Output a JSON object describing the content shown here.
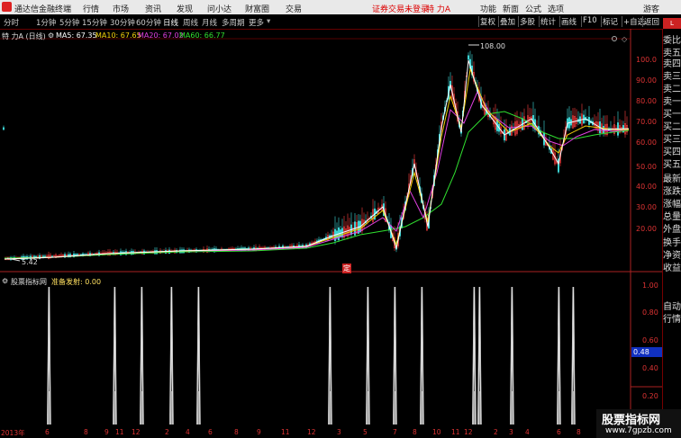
{
  "titlebar": {
    "app_title": "通达信金融终端",
    "menus": [
      "行情",
      "市场",
      "资讯",
      "发现",
      "问小达",
      "财富圈",
      "交易"
    ],
    "notice": "证券交易未登录",
    "stock": "特 力A",
    "right": [
      "功能",
      "新面",
      "公式",
      "选项",
      "游客"
    ]
  },
  "periods": [
    "分时",
    "1分钟",
    "5分钟",
    "15分钟",
    "30分钟",
    "60分钟",
    "日线",
    "周线",
    "月线",
    "多周期",
    "更多"
  ],
  "toolbar": [
    "复权",
    "叠加",
    "多股",
    "统计",
    "画线",
    "F10",
    "标记",
    "+自选",
    "返回"
  ],
  "main_chart": {
    "name_label": "特 力A (日线)",
    "ma": [
      {
        "label": "MA5: 67.35",
        "color": "#ffffff"
      },
      {
        "label": "MA10: 67.65",
        "color": "#f2d20a"
      },
      {
        "label": "MA20: 67.02",
        "color": "#e040e0"
      },
      {
        "label": "MA60: 66.77",
        "color": "#30e030"
      }
    ],
    "high_label": "108.00",
    "low_label": "5.42",
    "flag_label": "定",
    "y_labels": [
      "100.0",
      "90.00",
      "80.00",
      "70.00",
      "60.00",
      "50.00",
      "40.00",
      "30.00",
      "20.00"
    ]
  },
  "indicator": {
    "title": "股票指标网",
    "line_label": "准备发射: 0.00",
    "y_labels": [
      "1.00",
      "0.80",
      "0.60",
      "0.40",
      "0.20"
    ],
    "current": "0.48"
  },
  "x_labels": [
    "2013年",
    "6",
    "8",
    "9",
    "11",
    "12",
    "2",
    "4",
    "6",
    "8",
    "9",
    "11",
    "12",
    "3",
    "5",
    "7",
    "8",
    "10",
    "11",
    "12",
    "2",
    "3",
    "4",
    "6",
    "8"
  ],
  "right_panel": [
    "委比",
    "卖五",
    "卖四",
    "卖三",
    "卖二",
    "卖一",
    "买一",
    "买二",
    "买三",
    "买四",
    "买五",
    "最新",
    "涨跌",
    "涨幅",
    "总量",
    "外盘",
    "换手",
    "净资",
    "收益",
    "自动",
    "行情"
  ],
  "watermark": {
    "title": "股票指标网",
    "url": "www.7gpzb.com"
  },
  "colors": {
    "up": "#ff4040",
    "down": "#40e0e0",
    "axis": "#c02020"
  }
}
